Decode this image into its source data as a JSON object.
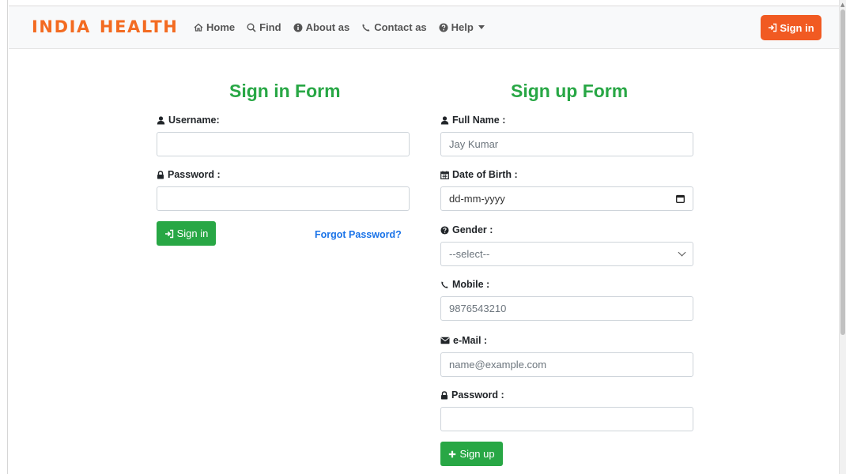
{
  "navbar": {
    "brand_word1": "INDIA",
    "brand_word2": "HEALTH",
    "links": [
      {
        "label": "Home",
        "icon": "home-icon"
      },
      {
        "label": "Find",
        "icon": "search-icon"
      },
      {
        "label": "About as",
        "icon": "info-icon"
      },
      {
        "label": "Contact as",
        "icon": "phone-icon"
      },
      {
        "label": "Help",
        "icon": "question-icon"
      }
    ],
    "signin_label": "Sign in"
  },
  "signin_form": {
    "title": "Sign in Form",
    "username_label": "Username:",
    "username_value": "",
    "password_label": "Password :",
    "password_value": "",
    "submit_label": "Sign in",
    "forgot_label": "Forgot Password?"
  },
  "signup_form": {
    "title": "Sign up Form",
    "fullname_label": "Full Name :",
    "fullname_placeholder": "Jay Kumar",
    "dob_label": "Date of Birth :",
    "dob_placeholder": "dd-mm-yyyy",
    "gender_label": "Gender :",
    "gender_selected": "--select--",
    "mobile_label": "Mobile :",
    "mobile_placeholder": "9876543210",
    "email_label": "e-Mail :",
    "email_placeholder": "name@example.com",
    "password_label": "Password :",
    "password_value": "",
    "submit_label": "Sign up"
  },
  "colors": {
    "brand": "#f36b21",
    "accent_orange": "#f15a22",
    "success_green": "#28a745",
    "link_blue": "#1a73e8",
    "navbar_bg": "#f8f9fa"
  }
}
